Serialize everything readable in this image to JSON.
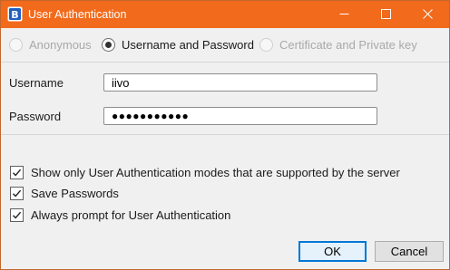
{
  "window": {
    "title": "User Authentication",
    "titlebar_color": "#f26a1b"
  },
  "auth_modes": [
    {
      "label": "Anonymous",
      "selected": false,
      "enabled": false
    },
    {
      "label": "Username and Password",
      "selected": true,
      "enabled": true
    },
    {
      "label": "Certificate and Private key",
      "selected": false,
      "enabled": false
    }
  ],
  "form": {
    "username_label": "Username",
    "username_value": "iivo",
    "password_label": "Password",
    "password_masked": "●●●●●●●●●●●"
  },
  "options": [
    {
      "label": "Show only User Authentication modes that are supported by the server",
      "checked": true
    },
    {
      "label": "Save Passwords",
      "checked": true
    },
    {
      "label": "Always prompt for User Authentication",
      "checked": true
    }
  ],
  "buttons": {
    "ok_label": "OK",
    "cancel_label": "Cancel",
    "ok_accent": "#0078d7"
  },
  "icons": {
    "app": "app-logo-icon",
    "minimize": "minimize-icon",
    "maximize": "maximize-icon",
    "close": "close-icon",
    "check": "checkmark-icon"
  }
}
